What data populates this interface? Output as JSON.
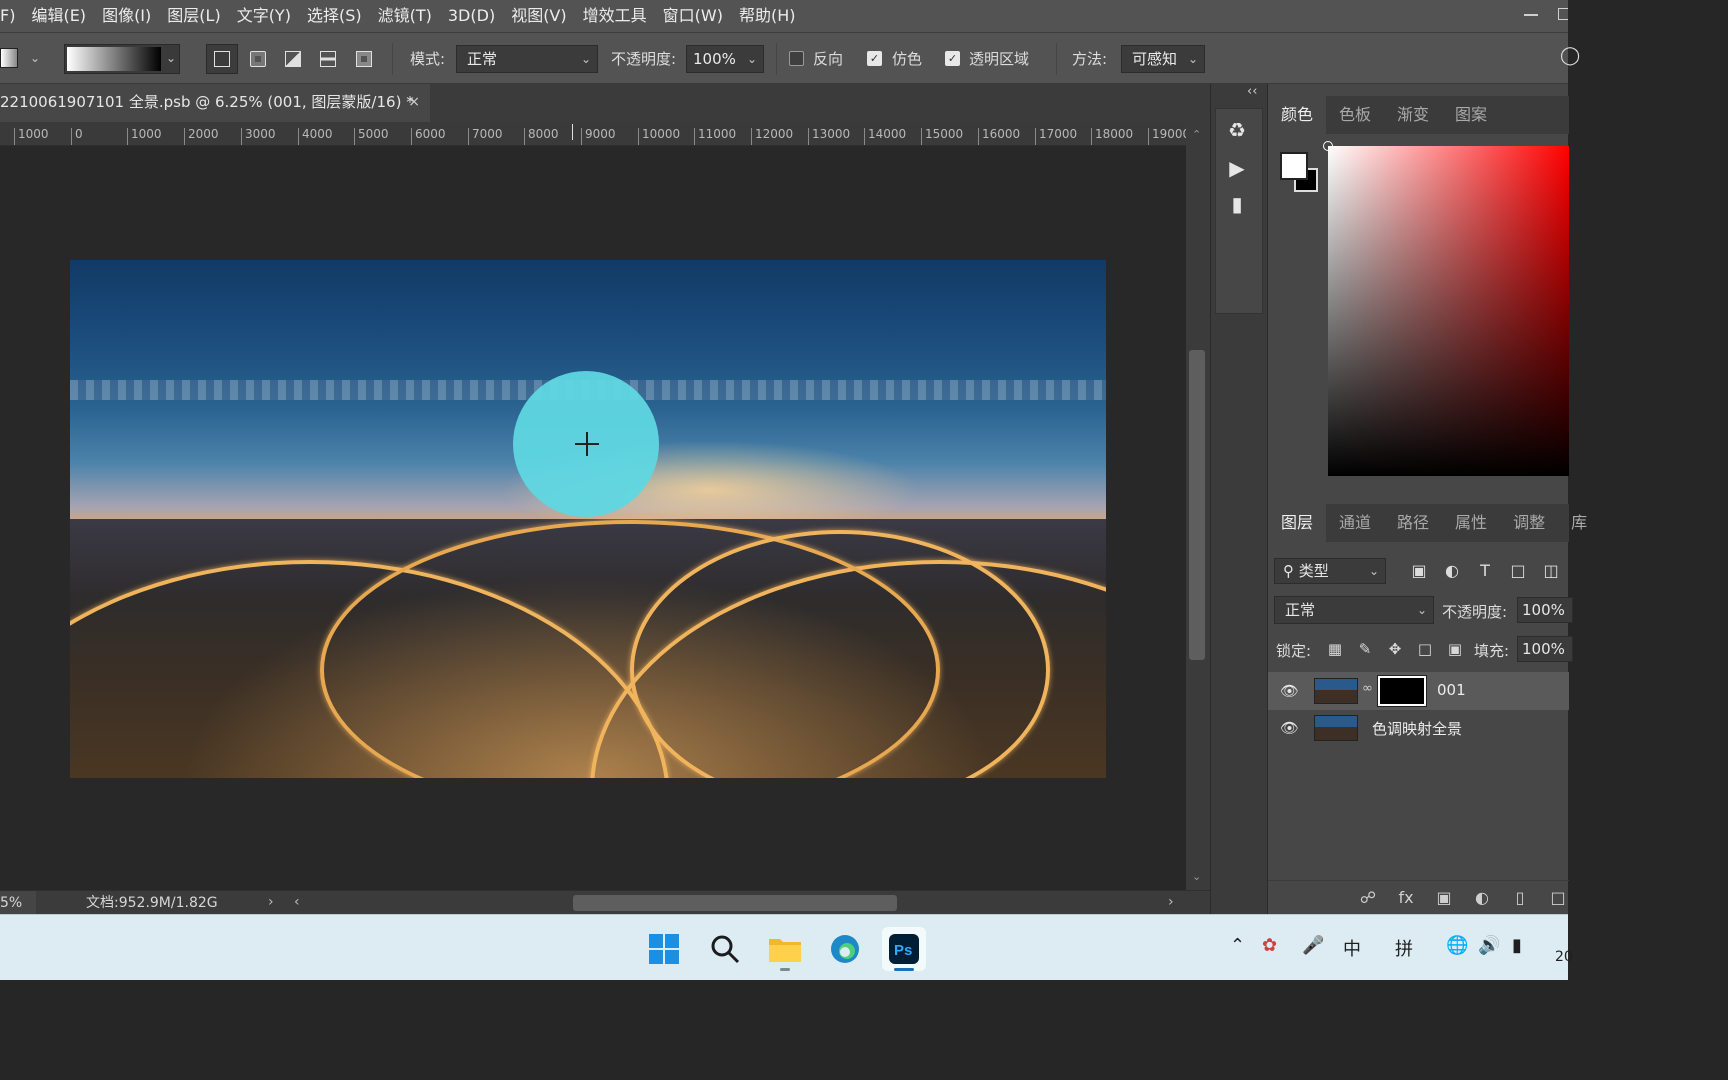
{
  "menu": [
    "F)",
    "编辑(E)",
    "图像(I)",
    "图层(L)",
    "文字(Y)",
    "选择(S)",
    "滤镜(T)",
    "3D(D)",
    "视图(V)",
    "增效工具",
    "窗口(W)",
    "帮助(H)"
  ],
  "options": {
    "mode_label": "模式:",
    "mode_value": "正常",
    "opacity_label": "不透明度:",
    "opacity_value": "100%",
    "reverse_label": "反向",
    "reverse_checked": false,
    "dither_label": "仿色",
    "dither_checked": true,
    "transparency_label": "透明区域",
    "transparency_checked": true,
    "method_label": "方法:",
    "method_value": "可感知"
  },
  "document": {
    "tab_title": "2210061907101 全景.psb @ 6.25% (001, 图层蒙版/16) *",
    "close": "×"
  },
  "ruler_ticks": [
    "1000",
    "0",
    "1000",
    "2000",
    "3000",
    "4000",
    "5000",
    "6000",
    "7000",
    "8000",
    "9000",
    "10000",
    "11000",
    "12000",
    "13000",
    "14000",
    "15000",
    "16000",
    "17000",
    "18000",
    "19000"
  ],
  "status": {
    "zoom": "5%",
    "doc_info": "文档:952.9M/1.82G"
  },
  "color_panel": {
    "tabs": [
      "颜色",
      "色板",
      "渐变",
      "图案"
    ],
    "active_tab": "颜色",
    "foreground": "#ffffff",
    "background": "#000000"
  },
  "layers_panel": {
    "tabs": [
      "图层",
      "通道",
      "路径",
      "属性",
      "调整",
      "库"
    ],
    "active_tab": "图层",
    "filter_label": "类型",
    "blend_mode": "正常",
    "opacity_label": "不透明度:",
    "opacity_value": "100%",
    "lock_label": "锁定:",
    "fill_label": "填充:",
    "fill_value": "100%",
    "layers": [
      {
        "name": "001",
        "visible": true,
        "selected": true,
        "has_mask": true
      },
      {
        "name": "色调映射全景",
        "visible": true,
        "selected": false,
        "has_mask": false
      }
    ]
  },
  "taskbar": {
    "ime_chinese": "中",
    "ime_pinyin": "拼",
    "clock_partial": "20"
  }
}
